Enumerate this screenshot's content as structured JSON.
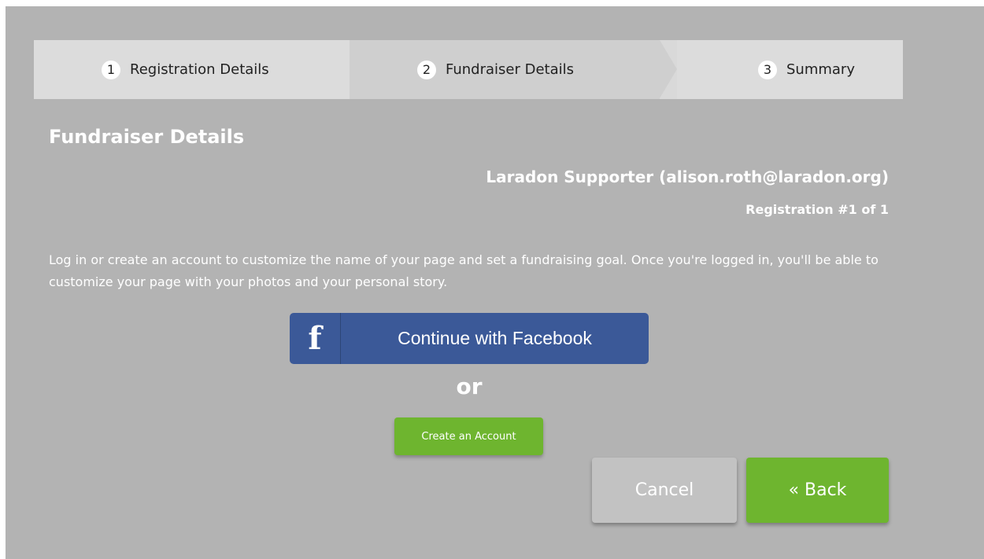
{
  "stepper": {
    "steps": [
      {
        "number": "1",
        "label": "Registration Details"
      },
      {
        "number": "2",
        "label": "Fundraiser Details"
      },
      {
        "number": "3",
        "label": "Summary"
      }
    ]
  },
  "page": {
    "title": "Fundraiser Details",
    "supporter": "Laradon Supporter (alison.roth@laradon.org)",
    "registration": "Registration #1 of 1",
    "intro": "Log in or create an account to customize the name of your page and set a fundraising goal. Once you're logged in, you'll be able to customize your page with your photos and your personal story."
  },
  "facebook": {
    "icon_glyph": "f",
    "label": "Continue with Facebook",
    "color": "#3b5998"
  },
  "or_text": "or",
  "create_account_label": "Create an Account",
  "actions": {
    "cancel_label": "Cancel",
    "back_label": "« Back"
  },
  "colors": {
    "background": "#b3b3b3",
    "accent_green": "#6eb52f"
  }
}
